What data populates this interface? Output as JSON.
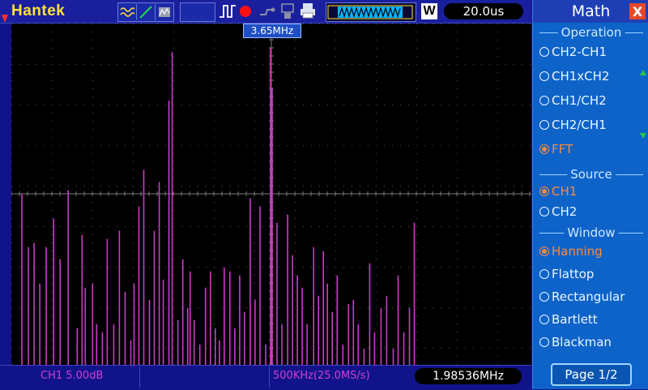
{
  "header": {
    "brand": "Hantek",
    "timebase": "20.0us",
    "mode_letter": "W"
  },
  "icons": [
    "waveform-icon",
    "slope-icon",
    "gray-wave-icon",
    "pulse-icon",
    "record-icon",
    "probe-icon",
    "usb-icon",
    "printer-icon"
  ],
  "colors": {
    "trace": "#c83cc8",
    "accent_orange": "#ff8a3a",
    "panel": "#0e63c9",
    "brand": "#ffe13a"
  },
  "display": {
    "cursor_freq": "3.65MHz",
    "ch1_scale": "CH1 5.00dB",
    "freq_span": "500KHz(25.0MS/s)",
    "measured_freq": "1.98536MHz"
  },
  "menu": {
    "title": "Math",
    "close": "X",
    "operation_header": "Operation",
    "operations": [
      "CH2-CH1",
      "CH1xCH2",
      "CH1/CH2",
      "CH2/CH1",
      "FFT"
    ],
    "operation_selected": "FFT",
    "source_header": "Source",
    "sources": [
      "CH1",
      "CH2"
    ],
    "source_selected": "CH1",
    "window_header": "Window",
    "windows": [
      "Hanning",
      "Flattop",
      "Rectangular",
      "Bartlett",
      "Blackman"
    ],
    "window_selected": "Hanning",
    "page": "Page 1/2"
  },
  "chart_data": {
    "type": "bar",
    "x_range_divisions": [
      0,
      12.8
    ],
    "y_range_divisions": [
      0,
      8.4
    ],
    "grid": true,
    "spikes": [
      {
        "x": 0.26,
        "y": 4.2
      },
      {
        "x": 0.42,
        "y": 2.9
      },
      {
        "x": 0.56,
        "y": 3.0
      },
      {
        "x": 0.7,
        "y": 2.0
      },
      {
        "x": 0.86,
        "y": 2.9
      },
      {
        "x": 1.04,
        "y": 3.6
      },
      {
        "x": 1.2,
        "y": 2.6
      },
      {
        "x": 1.4,
        "y": 4.3
      },
      {
        "x": 1.62,
        "y": 0.9
      },
      {
        "x": 1.74,
        "y": 3.2
      },
      {
        "x": 1.82,
        "y": 1.9
      },
      {
        "x": 2.0,
        "y": 2.0
      },
      {
        "x": 2.1,
        "y": 1.0
      },
      {
        "x": 2.24,
        "y": 0.8
      },
      {
        "x": 2.36,
        "y": 3.1
      },
      {
        "x": 2.52,
        "y": 1.0
      },
      {
        "x": 2.66,
        "y": 3.3
      },
      {
        "x": 2.8,
        "y": 1.8
      },
      {
        "x": 2.94,
        "y": 0.6
      },
      {
        "x": 3.02,
        "y": 2.0
      },
      {
        "x": 3.14,
        "y": 3.9
      },
      {
        "x": 3.26,
        "y": 4.8
      },
      {
        "x": 3.4,
        "y": 1.6
      },
      {
        "x": 3.52,
        "y": 3.3
      },
      {
        "x": 3.64,
        "y": 4.5
      },
      {
        "x": 3.74,
        "y": 2.1
      },
      {
        "x": 3.88,
        "y": 6.5
      },
      {
        "x": 3.96,
        "y": 7.7
      },
      {
        "x": 4.1,
        "y": 1.1
      },
      {
        "x": 4.22,
        "y": 2.6
      },
      {
        "x": 4.34,
        "y": 1.4
      },
      {
        "x": 4.4,
        "y": 2.3
      },
      {
        "x": 4.5,
        "y": 1.1
      },
      {
        "x": 4.64,
        "y": 0.5
      },
      {
        "x": 4.78,
        "y": 1.9
      },
      {
        "x": 4.9,
        "y": 2.3
      },
      {
        "x": 5.02,
        "y": 0.9
      },
      {
        "x": 5.12,
        "y": 0.6
      },
      {
        "x": 5.24,
        "y": 2.4
      },
      {
        "x": 5.38,
        "y": 2.3
      },
      {
        "x": 5.5,
        "y": 0.9
      },
      {
        "x": 5.62,
        "y": 2.2
      },
      {
        "x": 5.74,
        "y": 1.3
      },
      {
        "x": 5.88,
        "y": 4.1
      },
      {
        "x": 6.0,
        "y": 1.6
      },
      {
        "x": 6.12,
        "y": 3.9
      },
      {
        "x": 6.26,
        "y": 0.5
      },
      {
        "x": 6.38,
        "y": 7.8
      },
      {
        "x": 6.42,
        "y": 6.8
      },
      {
        "x": 6.54,
        "y": 3.5
      },
      {
        "x": 6.66,
        "y": 1.0
      },
      {
        "x": 6.8,
        "y": 3.7
      },
      {
        "x": 6.92,
        "y": 2.7
      },
      {
        "x": 7.04,
        "y": 2.2
      },
      {
        "x": 7.16,
        "y": 1.9
      },
      {
        "x": 7.28,
        "y": 1.0
      },
      {
        "x": 7.44,
        "y": 2.9
      },
      {
        "x": 7.56,
        "y": 1.7
      },
      {
        "x": 7.68,
        "y": 2.8
      },
      {
        "x": 7.78,
        "y": 2.0
      },
      {
        "x": 7.9,
        "y": 1.3
      },
      {
        "x": 8.02,
        "y": 2.2
      },
      {
        "x": 8.16,
        "y": 0.5
      },
      {
        "x": 8.3,
        "y": 1.5
      },
      {
        "x": 8.42,
        "y": 1.6
      },
      {
        "x": 8.54,
        "y": 1.0
      },
      {
        "x": 8.68,
        "y": 0.4
      },
      {
        "x": 8.82,
        "y": 2.5
      },
      {
        "x": 8.94,
        "y": 0.8
      },
      {
        "x": 9.1,
        "y": 1.4
      },
      {
        "x": 9.24,
        "y": 1.7
      },
      {
        "x": 9.4,
        "y": 0.4
      },
      {
        "x": 9.52,
        "y": 2.2
      },
      {
        "x": 9.66,
        "y": 0.8
      },
      {
        "x": 9.8,
        "y": 1.4
      },
      {
        "x": 9.92,
        "y": 3.5
      }
    ]
  }
}
